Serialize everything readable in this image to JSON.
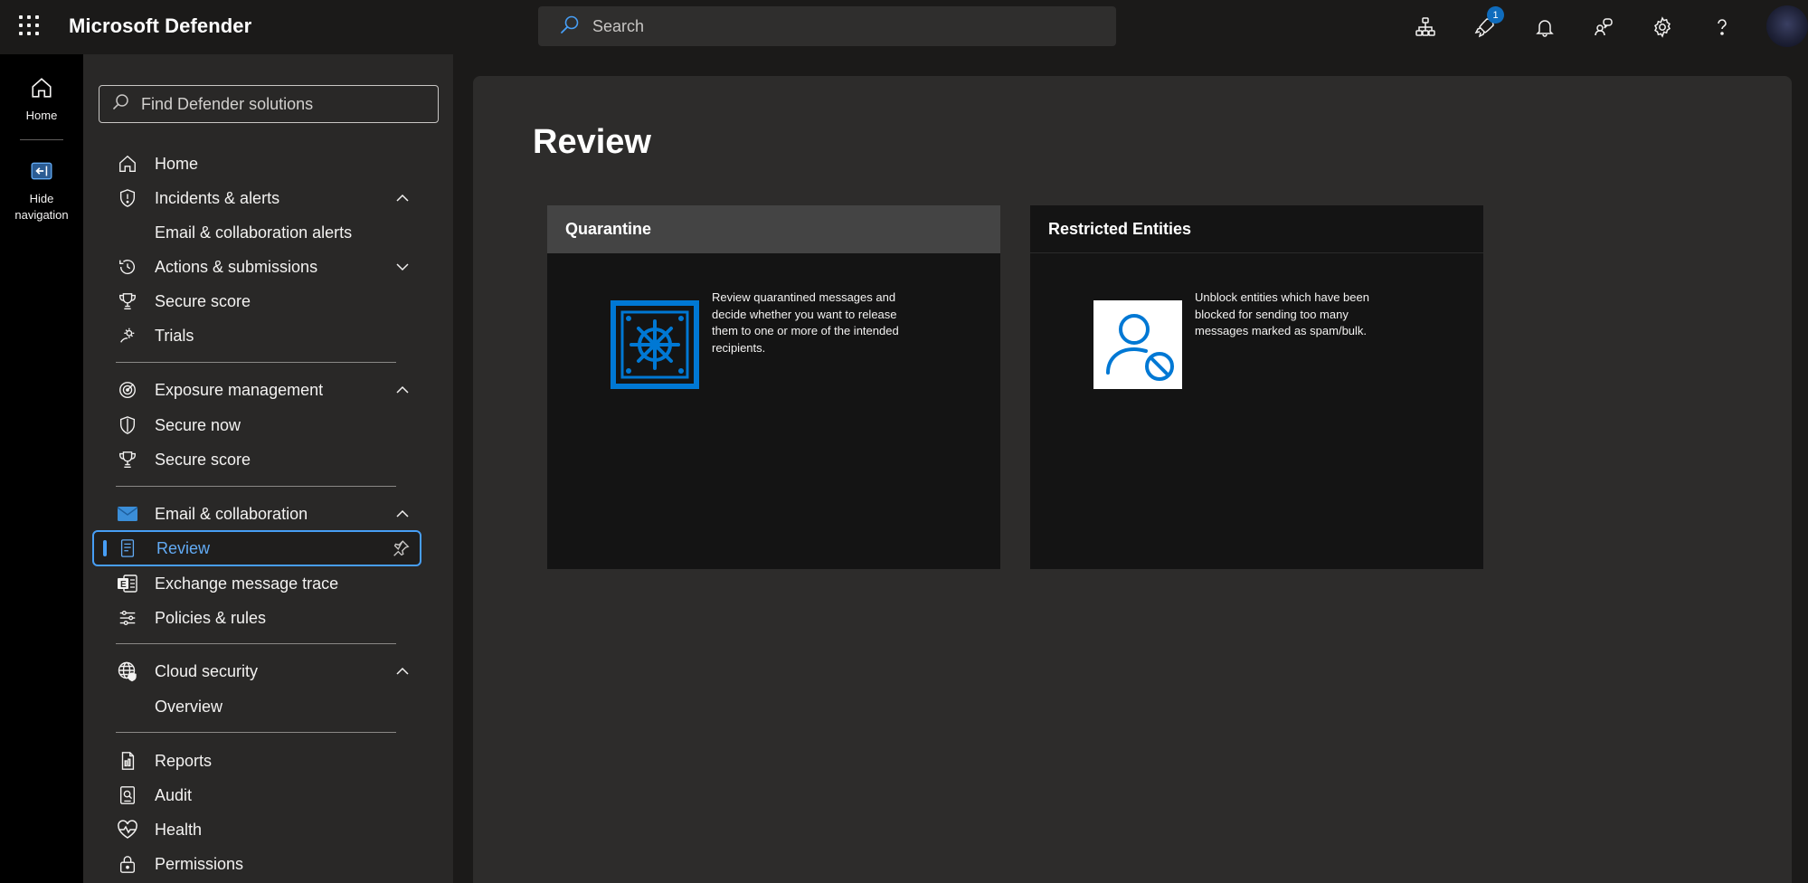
{
  "app": {
    "title": "Microsoft Defender"
  },
  "search": {
    "placeholder": "Search"
  },
  "header_icons": {
    "items": [
      "org-chart-icon",
      "rocket-icon",
      "bell-icon",
      "community-icon",
      "gear-icon",
      "help-icon"
    ],
    "notification_badge": "1"
  },
  "rail": {
    "home_label": "Home",
    "hide_nav_label_line1": "Hide",
    "hide_nav_label_line2": "navigation"
  },
  "nav": {
    "find_placeholder": "Find Defender solutions",
    "home": "Home",
    "incidents": "Incidents & alerts",
    "email_alerts": "Email & collaboration alerts",
    "actions": "Actions & submissions",
    "secure_score_1": "Secure score",
    "trials": "Trials",
    "exposure": "Exposure management",
    "secure_now": "Secure now",
    "secure_score_2": "Secure score",
    "email_collab": "Email & collaboration",
    "review": "Review",
    "exchange_trace": "Exchange message trace",
    "policies": "Policies & rules",
    "cloud_security": "Cloud security",
    "overview": "Overview",
    "reports": "Reports",
    "audit": "Audit",
    "health": "Health",
    "permissions": "Permissions"
  },
  "main": {
    "title": "Review",
    "cards": [
      {
        "title": "Quarantine",
        "text": "Review quarantined messages and decide whether you want to release them to one or more of the intended recipients."
      },
      {
        "title": "Restricted Entities",
        "text": "Unblock entities which have been blocked for sending too many messages marked as spam/bulk."
      }
    ]
  },
  "colors": {
    "accent": "#479ef5",
    "brand_blue": "#0078d4",
    "topbar": "#1b1a19",
    "nav_bg": "#292827",
    "rail_bg": "#000000"
  }
}
